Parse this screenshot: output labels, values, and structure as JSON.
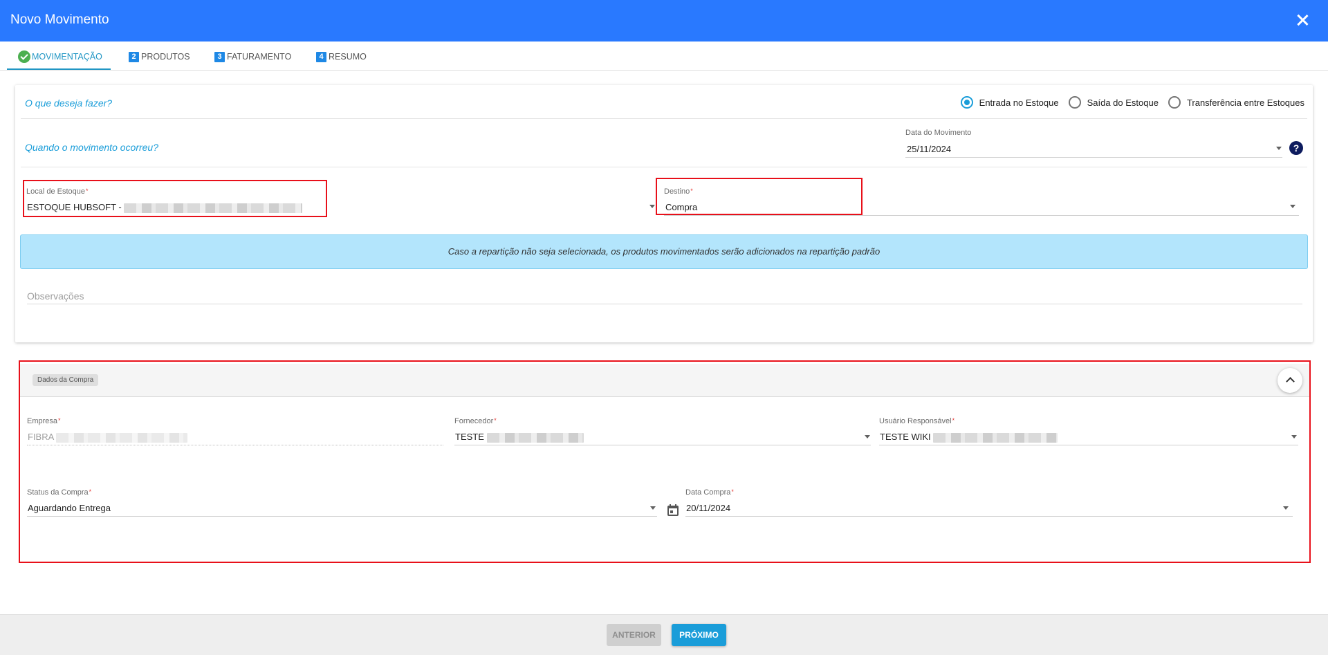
{
  "header": {
    "title": "Novo Movimento"
  },
  "tabs": [
    {
      "label": "MOVIMENTAÇÃO",
      "number": "",
      "state": "done"
    },
    {
      "label": "PRODUTOS",
      "number": "2"
    },
    {
      "label": "FATURAMENTO",
      "number": "3"
    },
    {
      "label": "RESUMO",
      "number": "4"
    }
  ],
  "movement": {
    "question_what": "O que deseja fazer?",
    "options": [
      "Entrada no Estoque",
      "Saída do Estoque",
      "Transferência entre Estoques"
    ],
    "selected_option": "Entrada no Estoque",
    "question_when": "Quando o movimento ocorreu?",
    "date_label": "Data do Movimento",
    "date_value": "25/11/2024",
    "help_icon": "?",
    "local_label": "Local de Estoque",
    "local_value": "ESTOQUE HUBSOFT -",
    "destino_label": "Destino",
    "destino_value": "Compra",
    "required_mark": "*",
    "info_text": "Caso a repartição não seja selecionada, os produtos movimentados serão adicionados na repartição padrão",
    "obs_placeholder": "Observações"
  },
  "purchase": {
    "section_title": "Dados da Compra",
    "empresa_label": "Empresa",
    "empresa_value": "FIBRA",
    "fornecedor_label": "Fornecedor",
    "fornecedor_value": "TESTE",
    "usuario_label": "Usuário Responsável",
    "usuario_value": "TESTE WIKI",
    "status_label": "Status da Compra",
    "status_value": "Aguardando Entrega",
    "data_compra_label": "Data Compra",
    "data_compra_value": "20/11/2024"
  },
  "footer": {
    "prev_label": "ANTERIOR",
    "next_label": "PRÓXIMO"
  },
  "colors": {
    "primary": "#2979ff",
    "accent": "#1a9dd9",
    "highlight": "#e8101a",
    "info_bg": "#b3e5fc",
    "success": "#4caf50"
  }
}
